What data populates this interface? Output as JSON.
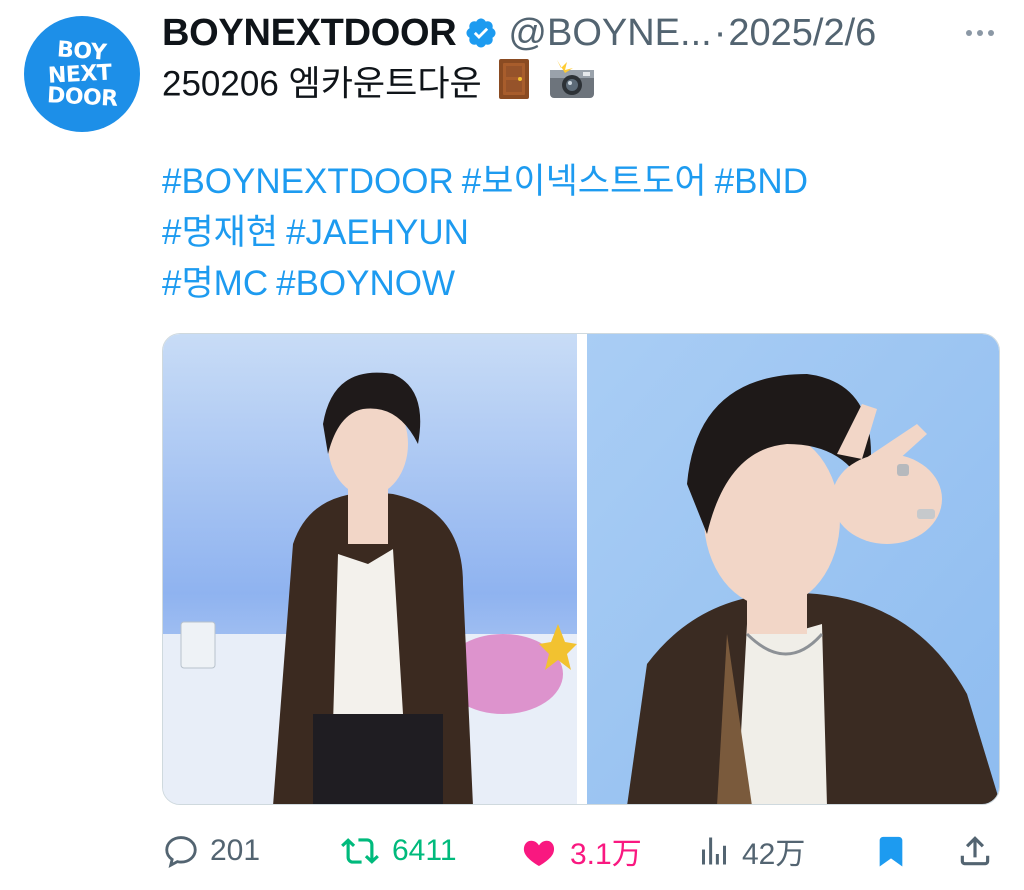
{
  "account": {
    "avatar_lines": [
      "BOY",
      "NEXT",
      "DOOR"
    ],
    "display_name": "BOYNEXTDOOR",
    "handle": "@BOYNE...",
    "separator": "·",
    "date": "2025/2/6",
    "verified_icon": "verified-badge-icon"
  },
  "tweet": {
    "text": "250206 엠카운트다운",
    "emojis": [
      "door-emoji",
      "camera-flash-emoji"
    ],
    "hashtag_lines": [
      [
        "#BOYNEXTDOOR",
        "#보이넥스트도어",
        "#BND"
      ],
      [
        "#명재현",
        "#JAEHYUN"
      ],
      [
        "#명MC",
        "#BOYNOW"
      ]
    ]
  },
  "media": {
    "photos": [
      "photo-1",
      "photo-2"
    ]
  },
  "actions": {
    "reply_count": "201",
    "retweet_count": "6411",
    "like_count": "3.1万",
    "view_count": "42万"
  },
  "colors": {
    "accent": "#1d9bf0",
    "retweet_active": "#00ba7c",
    "like_active": "#f91880",
    "muted": "#536471",
    "avatar_bg": "#1d8fe8"
  }
}
